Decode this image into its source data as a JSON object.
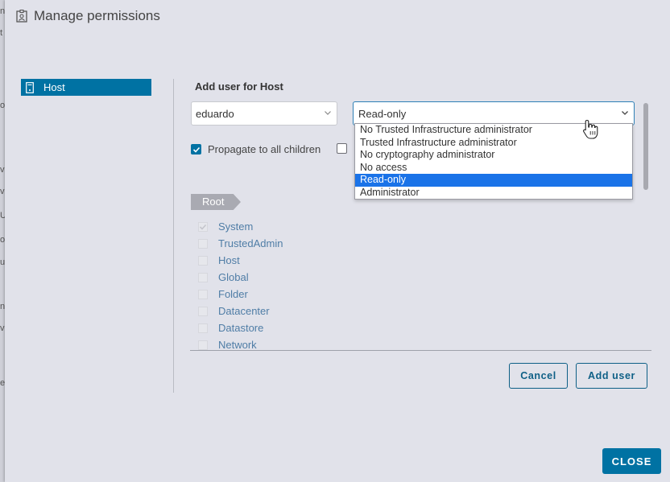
{
  "window": {
    "title": "Manage permissions",
    "title_icon": "id-badge-icon"
  },
  "tree": {
    "items": [
      {
        "label": "Host",
        "icon": "host-icon",
        "selected": true
      }
    ]
  },
  "form": {
    "section_title": "Add user for Host",
    "user_value": "eduardo",
    "role_selected": "Read-only",
    "role_options": [
      "No Trusted Infrastructure administrator",
      "Trusted Infrastructure administrator",
      "No cryptography administrator",
      "No access",
      "Read-only",
      "Administrator"
    ],
    "role_highlighted_index": 4,
    "propagate_label": "Propagate to all children",
    "propagate_checked": true
  },
  "privileges": {
    "root_label": "Root",
    "items": [
      "System",
      "TrustedAdmin",
      "Host",
      "Global",
      "Folder",
      "Datacenter",
      "Datastore",
      "Network"
    ]
  },
  "buttons": {
    "cancel": "Cancel",
    "add_user": "Add user",
    "close": "CLOSE"
  },
  "colors": {
    "accent": "#0072a3",
    "highlight": "#1a73e8"
  }
}
